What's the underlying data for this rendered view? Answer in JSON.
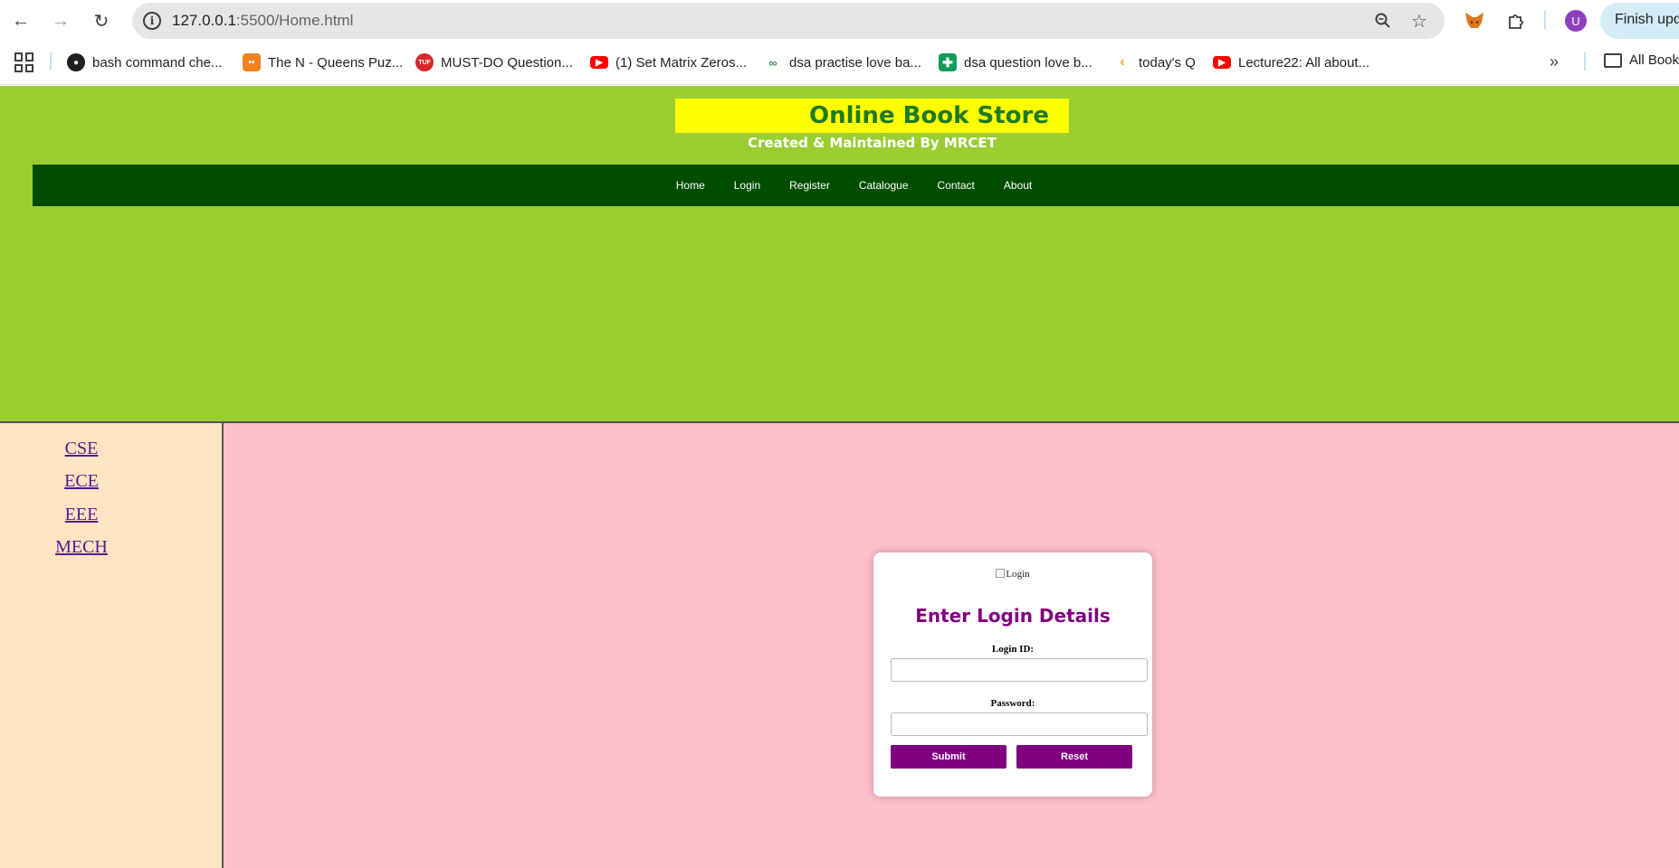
{
  "browser": {
    "url_host": "127.0.0.1",
    "url_rest": ":5500/Home.html",
    "update_label": "Finish update",
    "profile_initial": "U",
    "bookmarks": [
      {
        "label": "bash command che...",
        "icon": "github-icon",
        "color": "#1f1f1f"
      },
      {
        "label": "The N - Queens Puz...",
        "icon": "codingninjas-icon",
        "color": "#f48120"
      },
      {
        "label": "MUST-DO Question...",
        "icon": "tuf-icon",
        "color": "#d62828"
      },
      {
        "label": "(1) Set Matrix Zeros...",
        "icon": "youtube-icon",
        "color": "#ff0000"
      },
      {
        "label": "dsa practise love ba...",
        "icon": "gfg-icon",
        "color": "#2f8d46"
      },
      {
        "label": "dsa question love b...",
        "icon": "sheets-icon",
        "color": "#0f9d58"
      },
      {
        "label": "today's Q",
        "icon": "leetcode-icon",
        "color": "#ffa116"
      },
      {
        "label": "Lecture22: All about...",
        "icon": "youtube-icon",
        "color": "#ff0000"
      }
    ],
    "all_bookmarks_label": "All Bookmarks"
  },
  "header": {
    "title": "Online Book Store",
    "subtitle": "Created & Maintained By MRCET",
    "nav": [
      "Home",
      "Login",
      "Register",
      "Catalogue",
      "Contact",
      "About"
    ]
  },
  "sidebar": {
    "links": [
      "CSE",
      "ECE",
      "EEE",
      "MECH"
    ]
  },
  "login": {
    "image_alt": "Login",
    "heading": "Enter Login Details",
    "id_label": "Login ID:",
    "password_label": "Password:",
    "id_value": "",
    "password_value": "",
    "submit_label": "Submit",
    "reset_label": "Reset"
  },
  "colors": {
    "header_bg": "#9acd32",
    "title_bg": "#ffff00",
    "title_text": "#1e7a1e",
    "navbar_bg": "#004d00",
    "left_frame_bg": "#ffe4c4",
    "right_frame_bg": "#ffc0cb",
    "accent_purple": "#800080"
  }
}
